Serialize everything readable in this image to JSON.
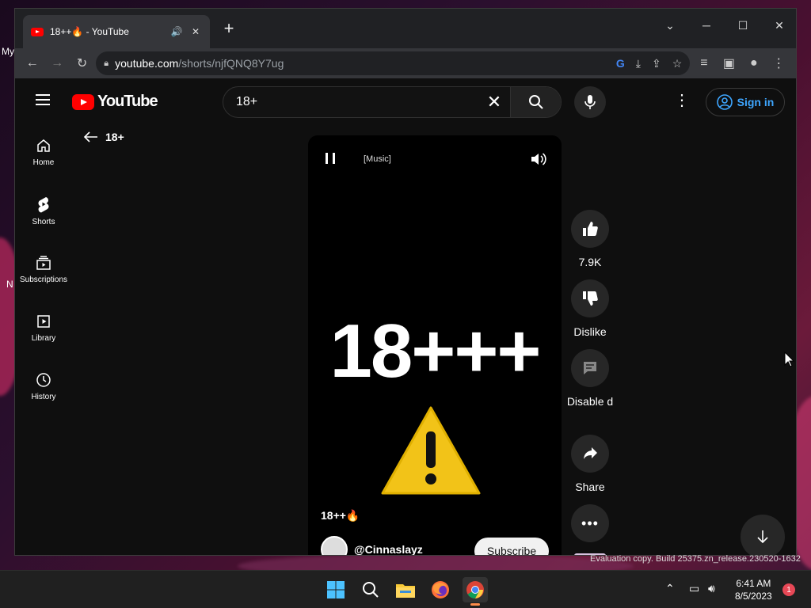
{
  "desktop": {
    "frag_top": "My",
    "frag_mid": "N",
    "watermark": "Evaluation copy. Build 25375.zn_release.230520-1632"
  },
  "browser": {
    "tab_title": "18++🔥 - YouTube",
    "url_host": "youtube.com",
    "url_path": "/shorts/njfQNQ8Y7ug"
  },
  "youtube": {
    "logo_text": "YouTube",
    "search_value": "18+",
    "signin_label": "Sign in",
    "sidebar": [
      {
        "label": "Home"
      },
      {
        "label": "Shorts"
      },
      {
        "label": "Subscriptions"
      },
      {
        "label": "Library"
      },
      {
        "label": "History"
      }
    ],
    "back_label": "18+",
    "player": {
      "caption": "[Music]",
      "overlay_text": "18+++",
      "video_title": "18++🔥",
      "channel": "@Cinnaslayz",
      "subscribe_label": "Subscribe"
    },
    "actions": {
      "like_count": "7.9K",
      "dislike_label": "Dislike",
      "comments_label": "Disable d",
      "share_label": "Share"
    }
  },
  "taskbar": {
    "time": "6:41 AM",
    "date": "8/5/2023",
    "notif_count": "1"
  }
}
